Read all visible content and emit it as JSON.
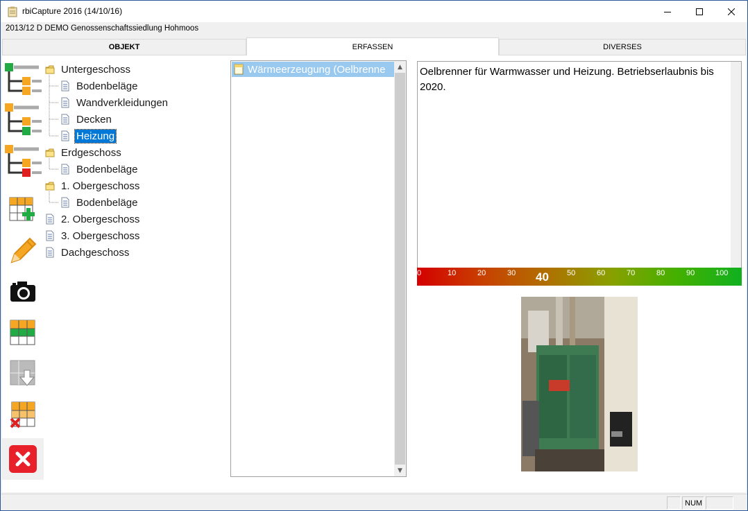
{
  "window": {
    "title": "rbiCapture 2016 (14/10/16)",
    "subtitle": "2013/12 D DEMO Genossenschaftssiedlung Hohmoos"
  },
  "tabs": [
    {
      "label": "OBJEKT",
      "active": false
    },
    {
      "label": "ERFASSEN",
      "active": true
    },
    {
      "label": "DIVERSES",
      "active": false
    }
  ],
  "toolbar": {
    "icons": [
      "tree-add-green-icon",
      "tree-add-orange-icon",
      "tree-remove-icon",
      "table-add-icon",
      "pencil-icon",
      "camera-icon",
      "table-row-icon",
      "table-import-icon",
      "table-delete-icon",
      "close-icon"
    ]
  },
  "tree": {
    "nodes": [
      {
        "label": "Untergeschoss",
        "level": 0,
        "type": "folder"
      },
      {
        "label": "Bodenbeläge",
        "level": 1,
        "type": "doc"
      },
      {
        "label": "Wandverkleidungen",
        "level": 1,
        "type": "doc"
      },
      {
        "label": "Decken",
        "level": 1,
        "type": "doc"
      },
      {
        "label": "Heizung",
        "level": 1,
        "type": "doc",
        "selected": true
      },
      {
        "label": "Erdgeschoss",
        "level": 0,
        "type": "folder"
      },
      {
        "label": "Bodenbeläge",
        "level": 1,
        "type": "doc"
      },
      {
        "label": "1. Obergeschoss",
        "level": 0,
        "type": "folder"
      },
      {
        "label": "Bodenbeläge",
        "level": 1,
        "type": "doc"
      },
      {
        "label": "2. Obergeschoss",
        "level": 0,
        "type": "doc"
      },
      {
        "label": "3. Obergeschoss",
        "level": 0,
        "type": "doc"
      },
      {
        "label": "Dachgeschoss",
        "level": 0,
        "type": "doc"
      }
    ]
  },
  "list": {
    "items": [
      {
        "label": "Wärmeerzeugung (Oelbrenne",
        "selected": true
      }
    ]
  },
  "description": {
    "text": "Oelbrenner für Warmwasser und Heizung. Betriebserlaubnis bis 2020."
  },
  "scale": {
    "ticks": [
      "0",
      "10",
      "20",
      "30",
      "50",
      "60",
      "70",
      "80",
      "90",
      "100"
    ],
    "value": "40"
  },
  "statusbar": {
    "num": "NUM"
  },
  "colors": {
    "selection": "#0078d7",
    "list_selection": "#99c9ef",
    "accent": "#2b579a"
  }
}
